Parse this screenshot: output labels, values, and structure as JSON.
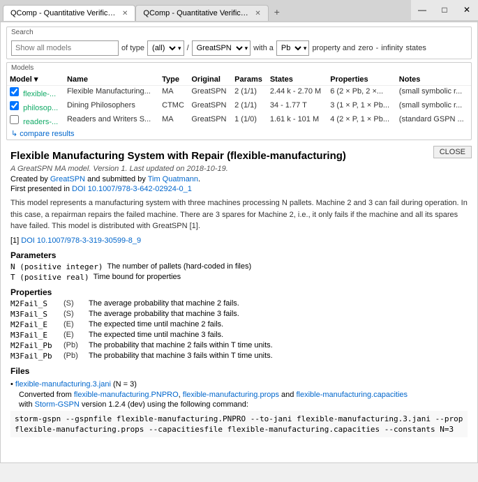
{
  "browser": {
    "tabs": [
      {
        "label": "QComp - Quantitative Verification...",
        "active": true
      },
      {
        "label": "QComp - Quantitative Verification...",
        "active": false
      }
    ],
    "new_tab_icon": "+",
    "win_controls": [
      "—",
      "□",
      "✕"
    ]
  },
  "search": {
    "section_label": "Search",
    "input_placeholder": "Show all models",
    "of_type_label": "of type",
    "type_options": [
      "(all)"
    ],
    "type_selected": "(all)",
    "tool_label": "GreatSPN",
    "tool_options": [
      "GreatSPN"
    ],
    "with_a_label": "with a",
    "prop_options": [
      "Pb"
    ],
    "prop_selected": "Pb",
    "property_label": "property and",
    "zero_label": "zero",
    "dash_label": "-",
    "infinity_label": "infinity",
    "states_label": "states"
  },
  "models": {
    "section_label": "Models",
    "columns": [
      "Model ▾",
      "Name",
      "Type",
      "Original",
      "Params",
      "States",
      "Properties",
      "Notes"
    ],
    "rows": [
      {
        "checkbox": true,
        "id": "flexible-...",
        "name": "Flexible Manufacturing...",
        "type": "MA",
        "original": "GreatSPN",
        "params": "2 (1/1)",
        "states": "2.44 k - 2.70 M",
        "properties": "6 (2 × Pb, 2 ×...",
        "notes": "(small symbolic r..."
      },
      {
        "checkbox": true,
        "id": "philosop...",
        "name": "Dining Philosophers",
        "type": "CTMC",
        "original": "GreatSPN",
        "params": "2 (1/1)",
        "states": "34 - 1.77 T",
        "properties": "3 (1 × P, 1 × Pb...",
        "notes": "(small symbolic r..."
      },
      {
        "checkbox": false,
        "id": "readers-...",
        "name": "Readers and Writers S...",
        "type": "MA",
        "original": "GreatSPN",
        "params": "1 (1/0)",
        "states": "1.61 k - 101 M",
        "properties": "4 (2 × P, 1 × Pb...",
        "notes": "(standard GSPN ..."
      }
    ],
    "compare_link": "↳ compare results"
  },
  "detail": {
    "close_label": "CLOSE",
    "title": "Flexible Manufacturing System with Repair (flexible-manufacturing)",
    "subtitle": "A GreatSPN MA model. Version 1. Last updated on 2018-10-19.",
    "created_by_prefix": "Created by ",
    "greatspn_link": "GreatSPN",
    "submitted_prefix": " and submitted by ",
    "tim_link": "Tim Quatmann",
    "submitted_suffix": ".",
    "first_presented_prefix": "First presented in ",
    "doi_link1": "DOI 10.1007/978-3-642-02924-0_1",
    "description": "This model represents a manufacturing system with three machines processing N pallets. Machine 2 and 3 can fail during operation. In this case, a repairman repairs the failed machine. There are 3 spares for Machine 2, i.e., it only fails if the machine and all its spares have failed. This model is distributed with GreatSPN [1].",
    "ref_number": "[1]",
    "ref_doi": "DOI 10.1007/978-3-319-30599-8_9",
    "params_header": "Parameters",
    "params": [
      {
        "name": "N (positive integer)",
        "desc": "The number of pallets (hard-coded in files)"
      },
      {
        "name": "T (positive real)",
        "desc": "Time bound for properties"
      }
    ],
    "props_header": "Properties",
    "props": [
      {
        "name": "M2Fail_S",
        "type": "(S)",
        "desc": "The average probability that machine 2 fails."
      },
      {
        "name": "M3Fail_S",
        "type": "(S)",
        "desc": "The average probability that machine 3 fails."
      },
      {
        "name": "M2Fail_E",
        "type": "(E)",
        "desc": "The expected time until machine 2 fails."
      },
      {
        "name": "M3Fail_E",
        "type": "(E)",
        "desc": "The expected time until machine 3 fails."
      },
      {
        "name": "M2Fail_Pb",
        "type": "(Pb)",
        "desc": "The probability that machine 2 fails within T time units."
      },
      {
        "name": "M3Fail_Pb",
        "type": "(Pb)",
        "desc": "The probability that machine 3 fails within T time units."
      }
    ],
    "files_header": "Files",
    "file_link1": "flexible-manufacturing.3.jani",
    "file_n_label": "(N = 3)",
    "converted_prefix": "Converted from ",
    "file_link2": "flexible-manufacturing.PNPRO",
    "comma_and": ", ",
    "file_link3": "flexible-manufacturing.props",
    "and_label": " and ",
    "file_link4": "flexible-manufacturing.capacities",
    "storm_prefix": "with ",
    "storm_link": "Storm-GSPN",
    "storm_version": " version 1.2.4 (dev) using the following command:",
    "code": "storm-gspn --gspnfile flexible-manufacturing.PNPRO --to-jani flexible-manufacturing.3.jani --prop flexible-manufacturing.props --capacitiesfile flexible-manufacturing.capacities --constants N=3"
  }
}
